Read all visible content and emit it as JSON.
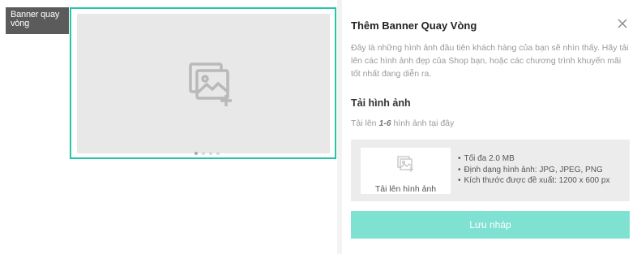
{
  "sidebar_tag": {
    "label": "Banner quay vòng"
  },
  "banner": {
    "dots_count": 4,
    "active_dot": 0
  },
  "panel": {
    "title": "Thêm Banner Quay Vòng",
    "description": "Đây là những hình ảnh đầu tiên khách hàng của bạn sẽ nhìn thấy. Hãy tải lên các hình ảnh đẹp của Shop bạn, hoặc các chương trình khuyến mãi tốt nhất đang diễn ra.",
    "upload_section_title": "Tải hình ảnh",
    "hint_prefix": "Tải lên",
    "hint_range": "1-6",
    "hint_suffix": "hình ảnh tại đây",
    "upload_button_label": "Tải lên hình ảnh",
    "specs": [
      "Tối đa 2.0 MB",
      "Định dạng hình ảnh: JPG, JPEG, PNG",
      "Kích thước được đề xuất: 1200 x 600 px"
    ],
    "save_label": "Lưu nháp"
  },
  "colors": {
    "accent": "#26c4a8",
    "save_button": "#7fe1d2",
    "tag_bg": "#5b5b5b"
  }
}
